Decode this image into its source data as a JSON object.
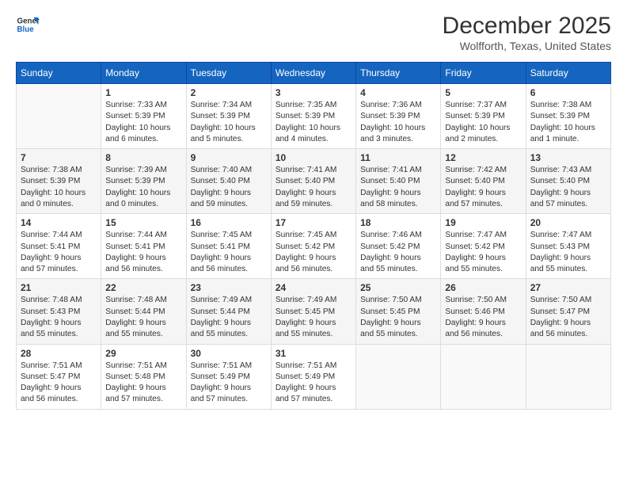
{
  "logo": {
    "line1": "General",
    "line2": "Blue"
  },
  "title": "December 2025",
  "subtitle": "Wolfforth, Texas, United States",
  "days_header": [
    "Sunday",
    "Monday",
    "Tuesday",
    "Wednesday",
    "Thursday",
    "Friday",
    "Saturday"
  ],
  "weeks": [
    [
      {
        "num": "",
        "info": ""
      },
      {
        "num": "1",
        "info": "Sunrise: 7:33 AM\nSunset: 5:39 PM\nDaylight: 10 hours\nand 6 minutes."
      },
      {
        "num": "2",
        "info": "Sunrise: 7:34 AM\nSunset: 5:39 PM\nDaylight: 10 hours\nand 5 minutes."
      },
      {
        "num": "3",
        "info": "Sunrise: 7:35 AM\nSunset: 5:39 PM\nDaylight: 10 hours\nand 4 minutes."
      },
      {
        "num": "4",
        "info": "Sunrise: 7:36 AM\nSunset: 5:39 PM\nDaylight: 10 hours\nand 3 minutes."
      },
      {
        "num": "5",
        "info": "Sunrise: 7:37 AM\nSunset: 5:39 PM\nDaylight: 10 hours\nand 2 minutes."
      },
      {
        "num": "6",
        "info": "Sunrise: 7:38 AM\nSunset: 5:39 PM\nDaylight: 10 hours\nand 1 minute."
      }
    ],
    [
      {
        "num": "7",
        "info": "Sunrise: 7:38 AM\nSunset: 5:39 PM\nDaylight: 10 hours\nand 0 minutes."
      },
      {
        "num": "8",
        "info": "Sunrise: 7:39 AM\nSunset: 5:39 PM\nDaylight: 10 hours\nand 0 minutes."
      },
      {
        "num": "9",
        "info": "Sunrise: 7:40 AM\nSunset: 5:40 PM\nDaylight: 9 hours\nand 59 minutes."
      },
      {
        "num": "10",
        "info": "Sunrise: 7:41 AM\nSunset: 5:40 PM\nDaylight: 9 hours\nand 59 minutes."
      },
      {
        "num": "11",
        "info": "Sunrise: 7:41 AM\nSunset: 5:40 PM\nDaylight: 9 hours\nand 58 minutes."
      },
      {
        "num": "12",
        "info": "Sunrise: 7:42 AM\nSunset: 5:40 PM\nDaylight: 9 hours\nand 57 minutes."
      },
      {
        "num": "13",
        "info": "Sunrise: 7:43 AM\nSunset: 5:40 PM\nDaylight: 9 hours\nand 57 minutes."
      }
    ],
    [
      {
        "num": "14",
        "info": "Sunrise: 7:44 AM\nSunset: 5:41 PM\nDaylight: 9 hours\nand 57 minutes."
      },
      {
        "num": "15",
        "info": "Sunrise: 7:44 AM\nSunset: 5:41 PM\nDaylight: 9 hours\nand 56 minutes."
      },
      {
        "num": "16",
        "info": "Sunrise: 7:45 AM\nSunset: 5:41 PM\nDaylight: 9 hours\nand 56 minutes."
      },
      {
        "num": "17",
        "info": "Sunrise: 7:45 AM\nSunset: 5:42 PM\nDaylight: 9 hours\nand 56 minutes."
      },
      {
        "num": "18",
        "info": "Sunrise: 7:46 AM\nSunset: 5:42 PM\nDaylight: 9 hours\nand 55 minutes."
      },
      {
        "num": "19",
        "info": "Sunrise: 7:47 AM\nSunset: 5:42 PM\nDaylight: 9 hours\nand 55 minutes."
      },
      {
        "num": "20",
        "info": "Sunrise: 7:47 AM\nSunset: 5:43 PM\nDaylight: 9 hours\nand 55 minutes."
      }
    ],
    [
      {
        "num": "21",
        "info": "Sunrise: 7:48 AM\nSunset: 5:43 PM\nDaylight: 9 hours\nand 55 minutes."
      },
      {
        "num": "22",
        "info": "Sunrise: 7:48 AM\nSunset: 5:44 PM\nDaylight: 9 hours\nand 55 minutes."
      },
      {
        "num": "23",
        "info": "Sunrise: 7:49 AM\nSunset: 5:44 PM\nDaylight: 9 hours\nand 55 minutes."
      },
      {
        "num": "24",
        "info": "Sunrise: 7:49 AM\nSunset: 5:45 PM\nDaylight: 9 hours\nand 55 minutes."
      },
      {
        "num": "25",
        "info": "Sunrise: 7:50 AM\nSunset: 5:45 PM\nDaylight: 9 hours\nand 55 minutes."
      },
      {
        "num": "26",
        "info": "Sunrise: 7:50 AM\nSunset: 5:46 PM\nDaylight: 9 hours\nand 56 minutes."
      },
      {
        "num": "27",
        "info": "Sunrise: 7:50 AM\nSunset: 5:47 PM\nDaylight: 9 hours\nand 56 minutes."
      }
    ],
    [
      {
        "num": "28",
        "info": "Sunrise: 7:51 AM\nSunset: 5:47 PM\nDaylight: 9 hours\nand 56 minutes."
      },
      {
        "num": "29",
        "info": "Sunrise: 7:51 AM\nSunset: 5:48 PM\nDaylight: 9 hours\nand 57 minutes."
      },
      {
        "num": "30",
        "info": "Sunrise: 7:51 AM\nSunset: 5:49 PM\nDaylight: 9 hours\nand 57 minutes."
      },
      {
        "num": "31",
        "info": "Sunrise: 7:51 AM\nSunset: 5:49 PM\nDaylight: 9 hours\nand 57 minutes."
      },
      {
        "num": "",
        "info": ""
      },
      {
        "num": "",
        "info": ""
      },
      {
        "num": "",
        "info": ""
      }
    ]
  ]
}
